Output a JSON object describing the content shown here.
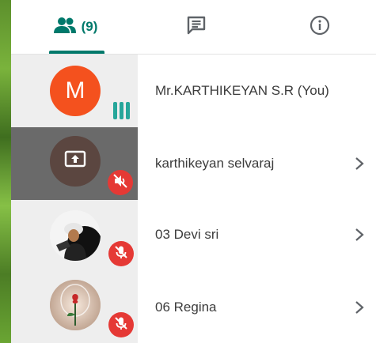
{
  "tabs": {
    "people_count": "(9)",
    "accent": "#00796b"
  },
  "participants": [
    {
      "name": "Mr.KARTHIKEYAN S.R (You)",
      "avatar_letter": "M",
      "avatar_color": "#f4511e",
      "status": "speaking-bars-icon"
    },
    {
      "name": "karthikeyan selvaraj",
      "avatar_icon": "present-screen-icon",
      "status": "muted-speaker-icon"
    },
    {
      "name": "03 Devi sri",
      "status": "mic-muted-icon"
    },
    {
      "name": "06 Regina",
      "status": "mic-muted-icon"
    }
  ]
}
